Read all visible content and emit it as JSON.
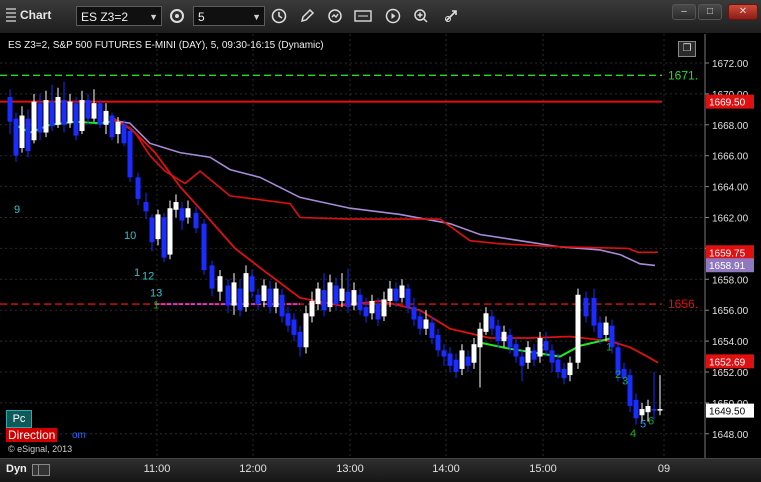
{
  "app": {
    "title": "Chart"
  },
  "toolbar": {
    "symbol": "ES Z3=2",
    "interval": "5"
  },
  "chart": {
    "info": "ES Z3=2, S&P 500 FUTURES E-MINI (DAY), 5, 09:30-16:15 (Dynamic)",
    "price_axis": [
      "1672.00",
      "1670.00",
      "1668.00",
      "1666.00",
      "1664.00",
      "1662.00",
      "1660.00",
      "1658.00",
      "1656.00",
      "1654.00",
      "1652.00",
      "1650.00",
      "1648.00"
    ],
    "time_axis": [
      "11:00",
      "12:00",
      "13:00",
      "14:00",
      "15:00",
      "09"
    ],
    "level_green_label": "1671.",
    "level_red_label": "1656.",
    "price_badges": {
      "red_line": "1669.50",
      "red_ma": "1659.75",
      "purple_vwap": "1658.91",
      "fast_ma": "1652.69",
      "last": "1649.50"
    },
    "counts": [
      {
        "text": "9",
        "color": "#27c8d0"
      },
      {
        "text": "10",
        "color": "#27c8d0"
      },
      {
        "text": "1",
        "color": "#27c8d0"
      },
      {
        "text": "12",
        "color": "#27c8d0"
      },
      {
        "text": "13",
        "color": "#27c8d0"
      },
      {
        "text": "1",
        "color": "#1faa1f"
      },
      {
        "text": "1",
        "color": "#1faa1f"
      },
      {
        "text": "2",
        "color": "#1faa1f"
      },
      {
        "text": "3",
        "color": "#1faa1f"
      },
      {
        "text": "4",
        "color": "#1faa1f"
      },
      {
        "text": "5",
        "color": "#2a9df4"
      },
      {
        "text": "6",
        "color": "#1faa1f"
      }
    ]
  },
  "branding": {
    "pc": "Pc",
    "direction": "Direction",
    "direction_suffix": "om",
    "copyright": "© eSignal, 2013"
  },
  "bottombar": {
    "mode": "Dyn"
  },
  "colors": {
    "bar_up": "#ffffff",
    "bar_down": "#1a2cff",
    "green_level": "#22dd22",
    "red_level": "#e01010",
    "vwap": "#a98ad8",
    "fast_ma": "#22e622",
    "magenta": "#ff33ff"
  }
}
